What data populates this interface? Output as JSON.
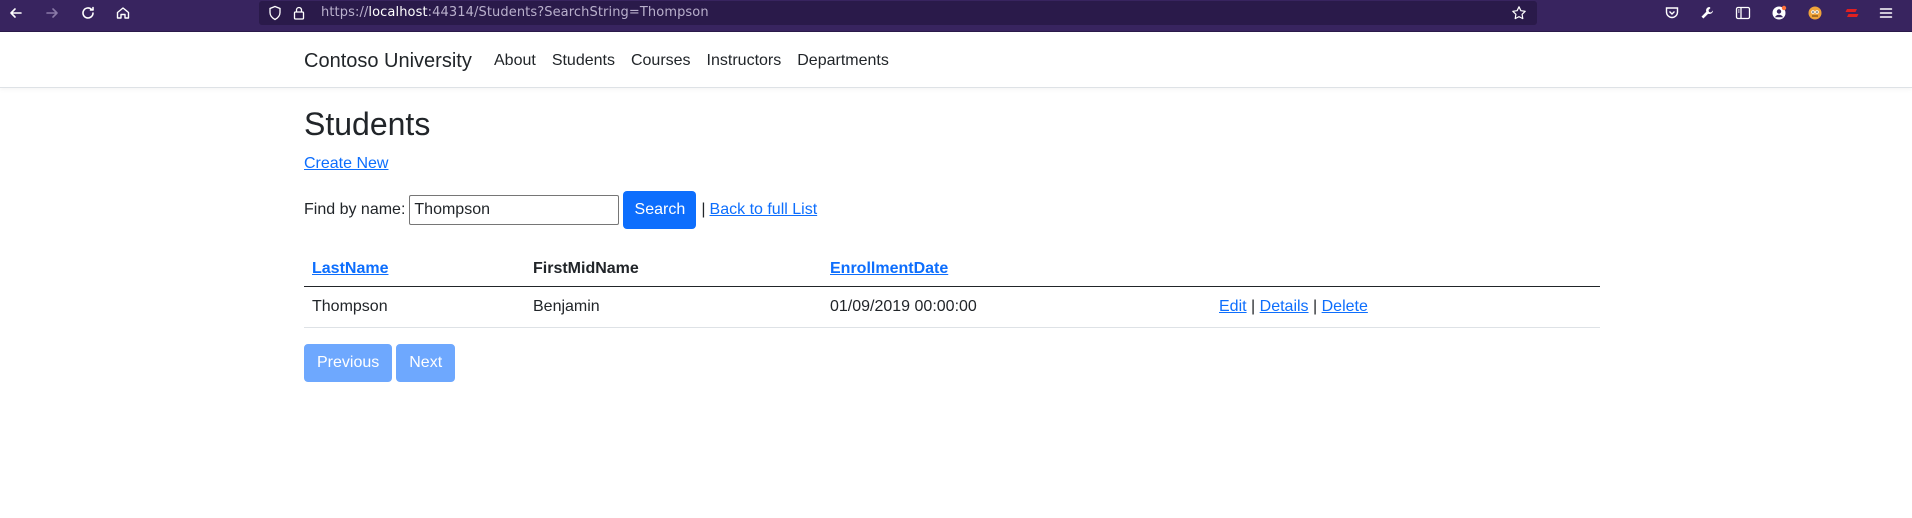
{
  "browser": {
    "url_scheme": "https://",
    "url_host": "localhost",
    "url_rest": ":44314/Students?SearchString=Thompson",
    "theme_color": "#38245f"
  },
  "navbar": {
    "brand": "Contoso University",
    "links": [
      "About",
      "Students",
      "Courses",
      "Instructors",
      "Departments"
    ]
  },
  "page": {
    "title": "Students",
    "create_link": "Create New",
    "find_label": "Find by name:",
    "search_value": "Thompson",
    "search_button": "Search",
    "separator": "|",
    "back_link": "Back to full List"
  },
  "table": {
    "headers": [
      "LastName",
      "FirstMidName",
      "EnrollmentDate"
    ],
    "rows": [
      {
        "last_name": "Thompson",
        "first_mid_name": "Benjamin",
        "enrollment_date": "01/09/2019 00:00:00",
        "edit": "Edit",
        "details": "Details",
        "delete": "Delete",
        "sep": "|"
      }
    ]
  },
  "pager": {
    "previous": "Previous",
    "next": "Next"
  },
  "colors": {
    "link": "#0d6efd",
    "primary": "#0d6efd",
    "disabled_primary": "#6ea8fe"
  }
}
